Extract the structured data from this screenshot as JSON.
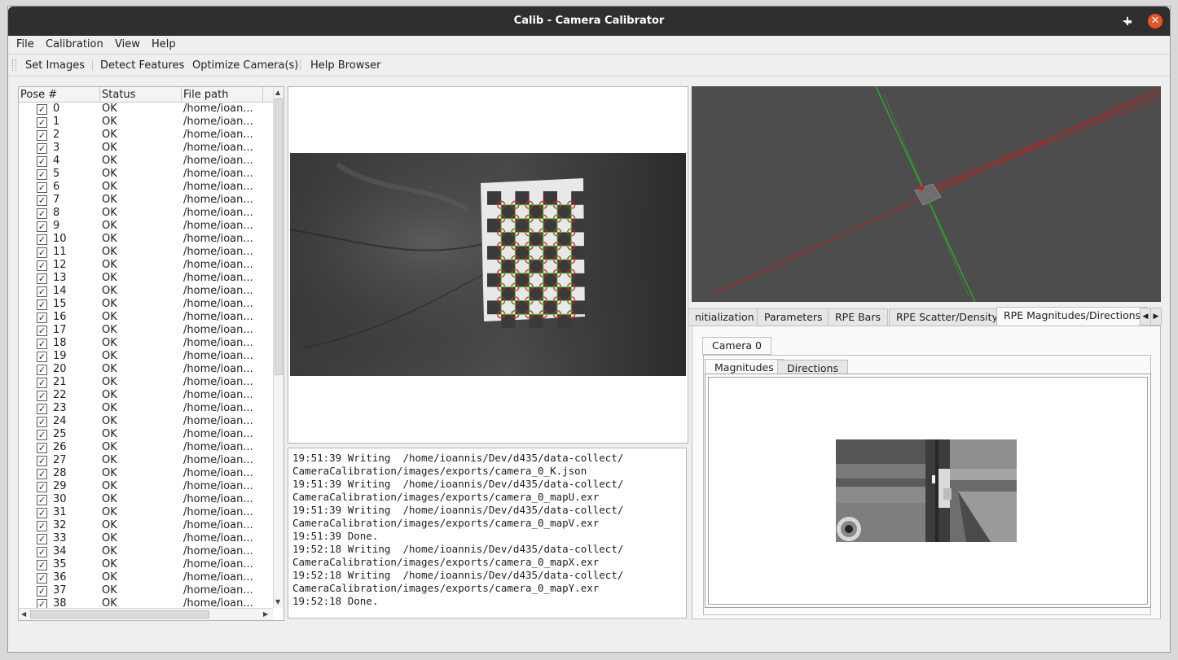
{
  "window": {
    "title": "Calib - Camera Calibrator",
    "max_glyph": "+",
    "close_glyph": "✕"
  },
  "menubar": [
    "File",
    "Calibration",
    "View",
    "Help"
  ],
  "toolbar": [
    "Set Images",
    "Detect Features",
    "Optimize Camera(s)",
    "Help Browser"
  ],
  "poses": {
    "columns": [
      "Pose #",
      "Status",
      "File path"
    ],
    "rows": [
      {
        "index": "0",
        "status": "OK",
        "path": "/home/ioan...",
        "checked": true
      },
      {
        "index": "1",
        "status": "OK",
        "path": "/home/ioan...",
        "checked": true
      },
      {
        "index": "2",
        "status": "OK",
        "path": "/home/ioan...",
        "checked": true
      },
      {
        "index": "3",
        "status": "OK",
        "path": "/home/ioan...",
        "checked": true
      },
      {
        "index": "4",
        "status": "OK",
        "path": "/home/ioan...",
        "checked": true
      },
      {
        "index": "5",
        "status": "OK",
        "path": "/home/ioan...",
        "checked": true
      },
      {
        "index": "6",
        "status": "OK",
        "path": "/home/ioan...",
        "checked": true
      },
      {
        "index": "7",
        "status": "OK",
        "path": "/home/ioan...",
        "checked": true
      },
      {
        "index": "8",
        "status": "OK",
        "path": "/home/ioan...",
        "checked": true
      },
      {
        "index": "9",
        "status": "OK",
        "path": "/home/ioan...",
        "checked": true
      },
      {
        "index": "10",
        "status": "OK",
        "path": "/home/ioan...",
        "checked": true
      },
      {
        "index": "11",
        "status": "OK",
        "path": "/home/ioan...",
        "checked": true
      },
      {
        "index": "12",
        "status": "OK",
        "path": "/home/ioan...",
        "checked": true
      },
      {
        "index": "13",
        "status": "OK",
        "path": "/home/ioan...",
        "checked": true
      },
      {
        "index": "14",
        "status": "OK",
        "path": "/home/ioan...",
        "checked": true
      },
      {
        "index": "15",
        "status": "OK",
        "path": "/home/ioan...",
        "checked": true
      },
      {
        "index": "16",
        "status": "OK",
        "path": "/home/ioan...",
        "checked": true
      },
      {
        "index": "17",
        "status": "OK",
        "path": "/home/ioan...",
        "checked": true
      },
      {
        "index": "18",
        "status": "OK",
        "path": "/home/ioan...",
        "checked": true
      },
      {
        "index": "19",
        "status": "OK",
        "path": "/home/ioan...",
        "checked": true
      },
      {
        "index": "20",
        "status": "OK",
        "path": "/home/ioan...",
        "checked": true
      },
      {
        "index": "21",
        "status": "OK",
        "path": "/home/ioan...",
        "checked": true
      },
      {
        "index": "22",
        "status": "OK",
        "path": "/home/ioan...",
        "checked": true
      },
      {
        "index": "23",
        "status": "OK",
        "path": "/home/ioan...",
        "checked": true
      },
      {
        "index": "24",
        "status": "OK",
        "path": "/home/ioan...",
        "checked": true
      },
      {
        "index": "25",
        "status": "OK",
        "path": "/home/ioan...",
        "checked": true
      },
      {
        "index": "26",
        "status": "OK",
        "path": "/home/ioan...",
        "checked": true
      },
      {
        "index": "27",
        "status": "OK",
        "path": "/home/ioan...",
        "checked": true
      },
      {
        "index": "28",
        "status": "OK",
        "path": "/home/ioan...",
        "checked": true
      },
      {
        "index": "29",
        "status": "OK",
        "path": "/home/ioan...",
        "checked": true
      },
      {
        "index": "30",
        "status": "OK",
        "path": "/home/ioan...",
        "checked": true
      },
      {
        "index": "31",
        "status": "OK",
        "path": "/home/ioan...",
        "checked": true
      },
      {
        "index": "32",
        "status": "OK",
        "path": "/home/ioan...",
        "checked": true
      },
      {
        "index": "33",
        "status": "OK",
        "path": "/home/ioan...",
        "checked": true
      },
      {
        "index": "34",
        "status": "OK",
        "path": "/home/ioan...",
        "checked": true
      },
      {
        "index": "35",
        "status": "OK",
        "path": "/home/ioan...",
        "checked": true
      },
      {
        "index": "36",
        "status": "OK",
        "path": "/home/ioan...",
        "checked": true
      },
      {
        "index": "37",
        "status": "OK",
        "path": "/home/ioan...",
        "checked": true
      },
      {
        "index": "38",
        "status": "OK",
        "path": "/home/ioan...",
        "checked": true
      }
    ]
  },
  "log": "19:51:39 Writing  /home/ioannis/Dev/d435/data-collect/\nCameraCalibration/images/exports/camera_0_K.json\n19:51:39 Writing  /home/ioannis/Dev/d435/data-collect/\nCameraCalibration/images/exports/camera_0_mapU.exr\n19:51:39 Writing  /home/ioannis/Dev/d435/data-collect/\nCameraCalibration/images/exports/camera_0_mapV.exr\n19:51:39 Done.\n19:52:18 Writing  /home/ioannis/Dev/d435/data-collect/\nCameraCalibration/images/exports/camera_0_mapX.exr\n19:52:18 Writing  /home/ioannis/Dev/d435/data-collect/\nCameraCalibration/images/exports/camera_0_mapY.exr\n19:52:18 Done.",
  "tabs": {
    "items": [
      "nitialization",
      "Parameters",
      "RPE Bars",
      "RPE Scatter/Density",
      "RPE Magnitudes/Directions"
    ],
    "active": "RPE Magnitudes/Directions",
    "camera_tab": "Camera 0",
    "subtabs": [
      "Magnitudes",
      "Directions"
    ],
    "active_subtab": "Magnitudes"
  },
  "colors": {
    "accent_close": "#e95420",
    "detected_corner": "#3cc83c",
    "corner_ring": "#d22020",
    "axis_red": "#c81e1e",
    "axis_green": "#28b428"
  }
}
